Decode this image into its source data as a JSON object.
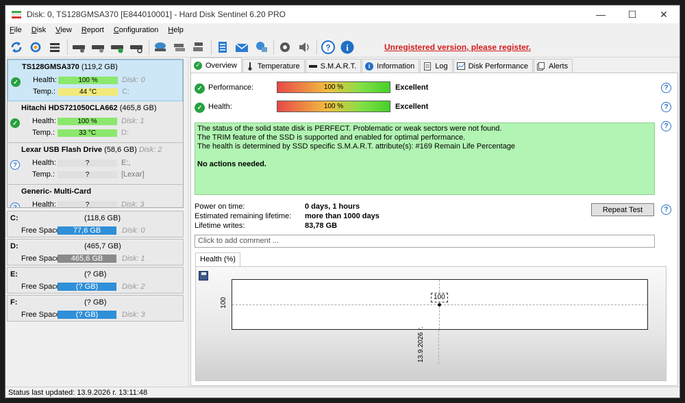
{
  "window": {
    "title": "Disk: 0, TS128GMSA370 [E844010001]  -  Hard Disk Sentinel 6.20 PRO",
    "minimize": "—",
    "maximize": "☐",
    "close": "✕"
  },
  "menu": [
    {
      "label": "File",
      "u": "F",
      "rest": "ile"
    },
    {
      "label": "Disk",
      "u": "D",
      "rest": "isk"
    },
    {
      "label": "View",
      "u": "V",
      "rest": "iew"
    },
    {
      "label": "Report",
      "u": "R",
      "rest": "eport"
    },
    {
      "label": "Configuration",
      "u": "C",
      "rest": "onfiguration"
    },
    {
      "label": "Help",
      "u": "H",
      "rest": "elp"
    }
  ],
  "toolbar": {
    "register_text": "Unregistered version, please register."
  },
  "disks": [
    {
      "name": "TS128GMSA370",
      "size": "(119,2 GB)",
      "disk_ref": "",
      "health": "100 %",
      "temp": "44 °C",
      "health_ref": "Disk: 0",
      "temp_ref": "C:",
      "status": "ok"
    },
    {
      "name": "Hitachi HDS721050CLA662",
      "size": "(465,8 GB)",
      "disk_ref": "",
      "health": "100 %",
      "temp": "33 °C",
      "health_ref": "Disk: 1",
      "temp_ref": "D:",
      "status": "ok"
    },
    {
      "name": "Lexar    USB Flash Drive",
      "size": "(58,6 GB)",
      "disk_ref": "Disk: 2",
      "health": "?",
      "temp": "?",
      "health_ref": "E:,",
      "temp_ref": "[Lexar]",
      "status": "unknown"
    },
    {
      "name": "Generic- Multi-Card",
      "size": "",
      "disk_ref": "",
      "health": "?",
      "temp": "",
      "health_ref": "Disk: 3",
      "temp_ref": "",
      "status": "unknown"
    }
  ],
  "labels": {
    "health": "Health:",
    "temp": "Temp.:",
    "free_space": "Free Space"
  },
  "partitions": [
    {
      "letter": "C:",
      "size": "(118,6 GB)",
      "free": "77,6 GB",
      "disk": "Disk: 0",
      "color": "#2f8fd8"
    },
    {
      "letter": "D:",
      "size": "(465,7 GB)",
      "free": "465,6 GB",
      "disk": "Disk: 1",
      "color": "#8a8a8a"
    },
    {
      "letter": "E:",
      "size": "(? GB)",
      "free": "(? GB)",
      "disk": "Disk: 2",
      "color": "#2f8fd8"
    },
    {
      "letter": "F:",
      "size": "(? GB)",
      "free": "(? GB)",
      "disk": "Disk: 3",
      "color": "#2f8fd8"
    }
  ],
  "tabs": [
    {
      "label": "Overview",
      "icon": "check-circle-icon"
    },
    {
      "label": "Temperature",
      "icon": "thermometer-icon"
    },
    {
      "label": "S.M.A.R.T.",
      "icon": "dash-icon"
    },
    {
      "label": "Information",
      "icon": "info-icon"
    },
    {
      "label": "Log",
      "icon": "log-icon"
    },
    {
      "label": "Disk Performance",
      "icon": "chart-icon"
    },
    {
      "label": "Alerts",
      "icon": "alerts-icon"
    }
  ],
  "overview": {
    "performance_label": "Performance:",
    "performance_value": "100 %",
    "performance_fraction": 1.0,
    "performance_text": "Excellent",
    "health_label": "Health:",
    "health_value": "100 %",
    "health_fraction": 1.0,
    "health_text": "Excellent",
    "status_lines": [
      "The status of the solid state disk is PERFECT. Problematic or weak sectors were not found.",
      "The TRIM feature of the SSD is supported and enabled for optimal performance.",
      "The health is determined by SSD specific S.M.A.R.T. attribute(s):  #169 Remain Life Percentage"
    ],
    "status_action": "No actions needed.",
    "power_on_label": "Power on time:",
    "power_on_value": "0 days, 1 hours",
    "remaining_label": "Estimated remaining lifetime:",
    "remaining_value": "more than 1000 days",
    "writes_label": "Lifetime writes:",
    "writes_value": "83,78 GB",
    "repeat_button": "Repeat Test",
    "comment_placeholder": "Click to add comment ..."
  },
  "graph": {
    "tab_label": "Health (%)",
    "chart_data": {
      "type": "line",
      "x": [
        "13.9.2026 г."
      ],
      "series": [
        {
          "values": [
            100
          ]
        }
      ],
      "ytick": "100",
      "point_label": "100"
    }
  },
  "statusbar": {
    "text": "Status last updated: 13.9.2026 г. 13:11:48"
  }
}
